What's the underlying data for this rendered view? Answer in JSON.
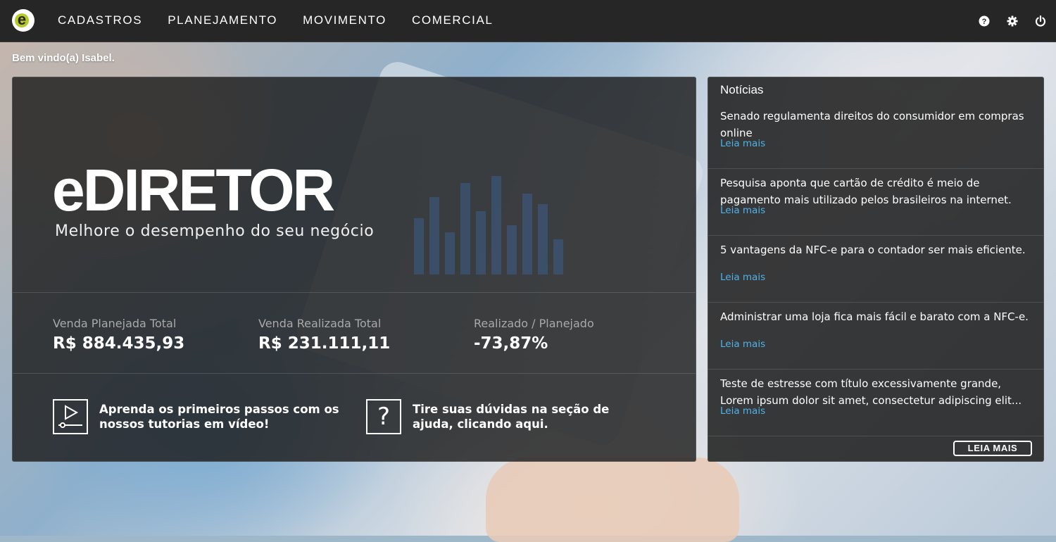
{
  "nav": {
    "items": [
      "CADASTROS",
      "PLANEJAMENTO",
      "MOVIMENTO",
      "COMERCIAL"
    ],
    "logo_letter": "e",
    "icons": [
      "help-icon",
      "gear-icon",
      "power-icon"
    ]
  },
  "welcome": "Bem vindo(a) Isabel.",
  "hero": {
    "brand": "eDIRETOR",
    "tagline": "Melhore o desempenho do seu negócio",
    "stats": [
      {
        "label": "Venda Planejada Total",
        "value": "R$ 884.435,93"
      },
      {
        "label": "Venda Realizada Total",
        "value": "R$ 231.111,11"
      },
      {
        "label": "Realizado / Planejado",
        "value": "-73,87%"
      }
    ],
    "cta_video": "Aprenda os primeiros passos com os nossos tutorias em vídeo!",
    "cta_help": "Tire suas dúvidas na seção de ajuda, clicando aqui."
  },
  "news": {
    "title": "Notícias",
    "items": [
      {
        "headline": "Senado regulamenta direitos do consumidor em compras online",
        "link": "Leia mais"
      },
      {
        "headline": "Pesquisa aponta que cartão de crédito é meio de pagamento mais utilizado pelos brasileiros na internet.",
        "link": "Leia mais"
      },
      {
        "headline": "5 vantagens da NFC-e para o contador ser mais eficiente.",
        "link": "Leia mais"
      },
      {
        "headline": "Administrar uma loja fica mais fácil e barato com a NFC-e.",
        "link": "Leia mais"
      },
      {
        "headline": "Teste de estresse com título excessivamente grande, Lorem ipsum dolor sit amet, consectetur adipiscing elit...",
        "link": "Leia mais"
      }
    ],
    "more_button": "LEIA MAIS"
  },
  "colors": {
    "topbar": "#262626",
    "logo_accent": "#b6c92c",
    "link": "#4fb2e8"
  }
}
